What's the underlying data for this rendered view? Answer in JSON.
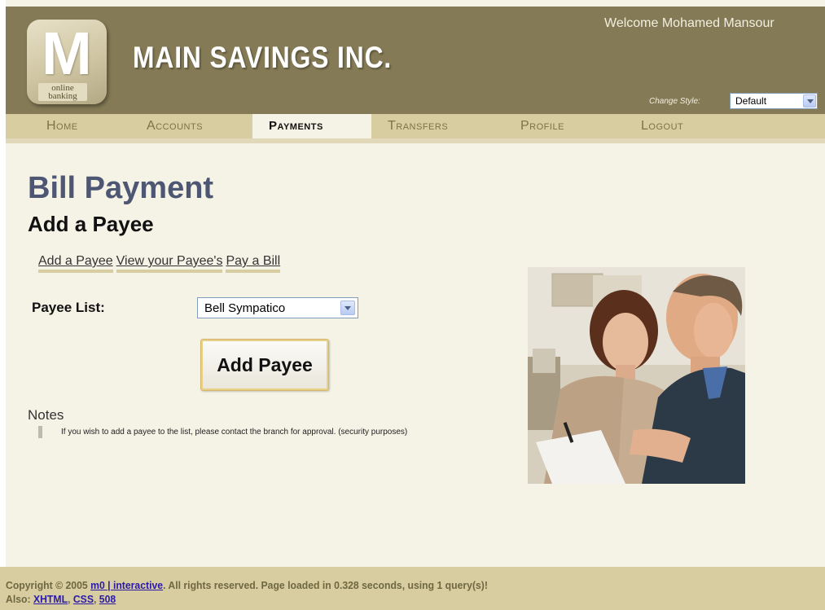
{
  "header": {
    "logo_letter": "M",
    "logo_sub": "online banking",
    "brand": "MAIN SAVINGS INC.",
    "welcome": "Welcome Mohamed Mansour",
    "change_style_label": "Change Style:",
    "style_value": "Default"
  },
  "nav": {
    "items": [
      {
        "label": "Home"
      },
      {
        "label": "Accounts"
      },
      {
        "label": "Payments"
      },
      {
        "label": "Transfers"
      },
      {
        "label": "Profile"
      },
      {
        "label": "Logout"
      }
    ],
    "active": "Payments"
  },
  "main": {
    "title": "Bill Payment",
    "subtitle": "Add a Payee",
    "sublinks": [
      "Add a Payee",
      "View your Payee's",
      "Pay a Bill"
    ],
    "payee_label": "Payee List:",
    "payee_value": "Bell Sympatico",
    "add_button": "Add Payee",
    "notes_title": "Notes",
    "notes_text": "If you wish to add a payee to the list, please contact the branch for approval. (security purposes)"
  },
  "footer": {
    "prefix": "Copyright © 2005 ",
    "company_link": "m0 | interactive",
    "suffix": ". All rights reserved. Page loaded in 0.328 seconds, using 1 query(s)!",
    "also_label": "Also: ",
    "links": [
      "XHTML",
      "CSS",
      "508"
    ]
  },
  "colors": {
    "header_bg": "#847a55",
    "nav_bg": "#d7cda1",
    "page_bg": "#f5f2e6",
    "title": "#4d5672",
    "link": "#2b1aa8"
  },
  "icons": {
    "dropdown": "chevron-down-icon",
    "photo": "couple-reviewing-bill-photo"
  }
}
